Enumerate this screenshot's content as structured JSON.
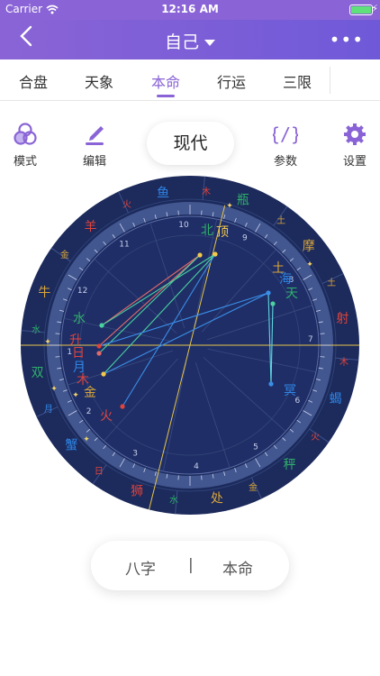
{
  "status": {
    "carrier": "Carrier",
    "time": "12:16 AM"
  },
  "nav": {
    "back_icon": "chevron-left-icon",
    "title": "自己",
    "more_icon": "ellipsis-icon"
  },
  "tabs": [
    {
      "label": "合盘",
      "active": false
    },
    {
      "label": "天象",
      "active": false
    },
    {
      "label": "本命",
      "active": true
    },
    {
      "label": "行运",
      "active": false
    },
    {
      "label": "三限",
      "active": false
    }
  ],
  "toolbar": {
    "mode_label": "模式",
    "edit_label": "编辑",
    "current_mode": "现代",
    "params_label": "参数",
    "settings_label": "设置"
  },
  "chart": {
    "signs": [
      {
        "glyph": "瓶",
        "color": "#2fb06b"
      },
      {
        "glyph": "鱼",
        "color": "#2f86e6"
      },
      {
        "glyph": "羊",
        "color": "#e0443c"
      },
      {
        "glyph": "牛",
        "color": "#d9a53a"
      },
      {
        "glyph": "双",
        "color": "#2fb06b"
      },
      {
        "glyph": "蟹",
        "color": "#2f86e6"
      },
      {
        "glyph": "狮",
        "color": "#e0443c"
      },
      {
        "glyph": "处",
        "color": "#d9a53a"
      },
      {
        "glyph": "秤",
        "color": "#2fb06b"
      },
      {
        "glyph": "蝎",
        "color": "#2f86e6"
      },
      {
        "glyph": "射",
        "color": "#e0443c"
      },
      {
        "glyph": "摩",
        "color": "#d9a53a"
      }
    ],
    "rulers": [
      {
        "glyph": "土",
        "color": "#d9a53a"
      },
      {
        "glyph": "木",
        "color": "#e0443c"
      },
      {
        "glyph": "火",
        "color": "#e0443c"
      },
      {
        "glyph": "金",
        "color": "#d9a53a"
      },
      {
        "glyph": "水",
        "color": "#2fb06b"
      },
      {
        "glyph": "月",
        "color": "#2f86e6"
      },
      {
        "glyph": "日",
        "color": "#e0443c"
      },
      {
        "glyph": "水",
        "color": "#2fb06b"
      },
      {
        "glyph": "金",
        "color": "#d9a53a"
      },
      {
        "glyph": "火",
        "color": "#e0443c"
      },
      {
        "glyph": "木",
        "color": "#e0443c"
      },
      {
        "glyph": "土",
        "color": "#d9a53a"
      }
    ],
    "houses": [
      "10",
      "9",
      "8",
      "7",
      "6",
      "5",
      "4",
      "3",
      "2",
      "1",
      "12",
      "11"
    ],
    "points": [
      {
        "glyph": "北",
        "color": "#2fb06b"
      },
      {
        "glyph": "顶",
        "color": "#f2c94c"
      },
      {
        "glyph": "土",
        "color": "#d9a53a"
      },
      {
        "glyph": "海",
        "color": "#2f86e6"
      },
      {
        "glyph": "天",
        "color": "#2fb06b"
      },
      {
        "glyph": "冥",
        "color": "#2f86e6"
      },
      {
        "glyph": "水",
        "color": "#2fb06b"
      },
      {
        "glyph": "升",
        "color": "#e0443c"
      },
      {
        "glyph": "日",
        "color": "#e0443c"
      },
      {
        "glyph": "月",
        "color": "#2f86e6"
      },
      {
        "glyph": "木",
        "color": "#e0443c"
      },
      {
        "glyph": "金",
        "color": "#d9a53a"
      },
      {
        "glyph": "火",
        "color": "#e0443c"
      }
    ]
  },
  "bottom_toggle": {
    "left": "八字",
    "separator": "|",
    "right": "本命"
  },
  "colors": {
    "accent": "#8a64d6",
    "chart_bg": "#1c2a5c",
    "chart_ring": "#3d4f86"
  }
}
